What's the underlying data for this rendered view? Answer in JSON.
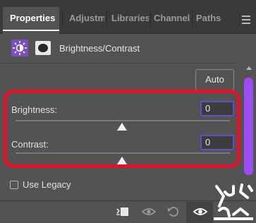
{
  "tabs": [
    {
      "label": "Properties",
      "active": true
    },
    {
      "label": "Adjustm",
      "active": false
    },
    {
      "label": "Libraries",
      "active": false
    },
    {
      "label": "Channels",
      "active": false
    },
    {
      "label": "Paths",
      "active": false
    }
  ],
  "header": {
    "title": "Brightness/Contrast",
    "adjustment_icon": "brightness-contrast-icon",
    "mask_icon": "layer-mask-icon"
  },
  "auto_label": "Auto",
  "brightness": {
    "label": "Brightness:",
    "value": "0",
    "slider_fraction": 0.5
  },
  "contrast": {
    "label": "Contrast:",
    "value": "0",
    "slider_fraction": 0.5
  },
  "use_legacy": {
    "label": "Use Legacy",
    "checked": false
  },
  "bottom_icons": [
    "clip-to-layer-icon",
    "view-previous-state-icon",
    "reset-icon",
    "visibility-eye-icon"
  ],
  "colors": {
    "panel_bg": "#535353",
    "tab_bar_bg": "#3a3a3a",
    "accent_purple": "#9e4bf2",
    "input_border": "#5c51c7",
    "highlight_red": "#e0142b"
  }
}
